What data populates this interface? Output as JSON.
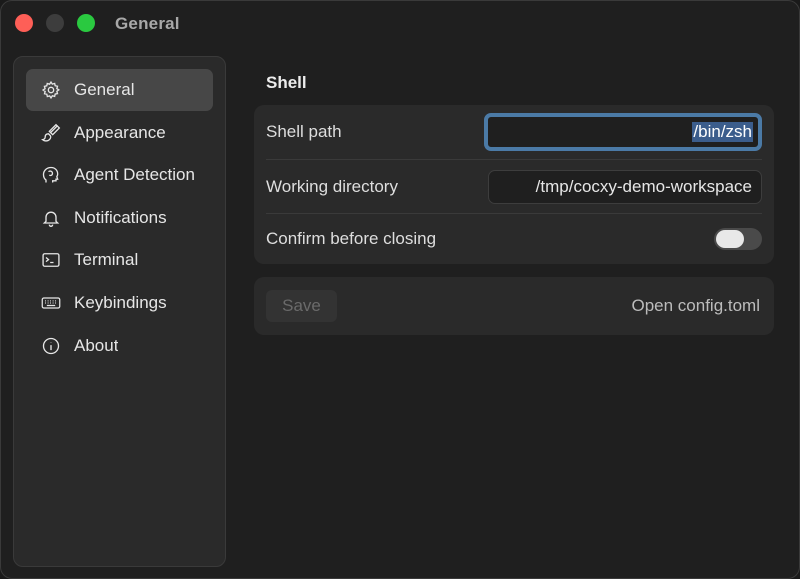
{
  "window": {
    "title": "General"
  },
  "sidebar": {
    "items": [
      {
        "label": "General",
        "icon": "gear-icon",
        "active": true
      },
      {
        "label": "Appearance",
        "icon": "paintbrush-icon",
        "active": false
      },
      {
        "label": "Agent Detection",
        "icon": "brain-head-icon",
        "active": false
      },
      {
        "label": "Notifications",
        "icon": "bell-icon",
        "active": false
      },
      {
        "label": "Terminal",
        "icon": "terminal-icon",
        "active": false
      },
      {
        "label": "Keybindings",
        "icon": "keyboard-icon",
        "active": false
      },
      {
        "label": "About",
        "icon": "info-icon",
        "active": false
      }
    ]
  },
  "main": {
    "section_title": "Shell",
    "shell_path": {
      "label": "Shell path",
      "value": "/bin/zsh"
    },
    "working_directory": {
      "label": "Working directory",
      "value": "/tmp/cocxy-demo-workspace"
    },
    "confirm_close": {
      "label": "Confirm before closing",
      "enabled": false
    },
    "actions": {
      "save_label": "Save",
      "open_config_label": "Open config.toml"
    }
  },
  "colors": {
    "accent_focus": "#4b7aa6",
    "selection": "#3b5d8c",
    "close": "#fe5f57",
    "maximize": "#2ac940"
  }
}
